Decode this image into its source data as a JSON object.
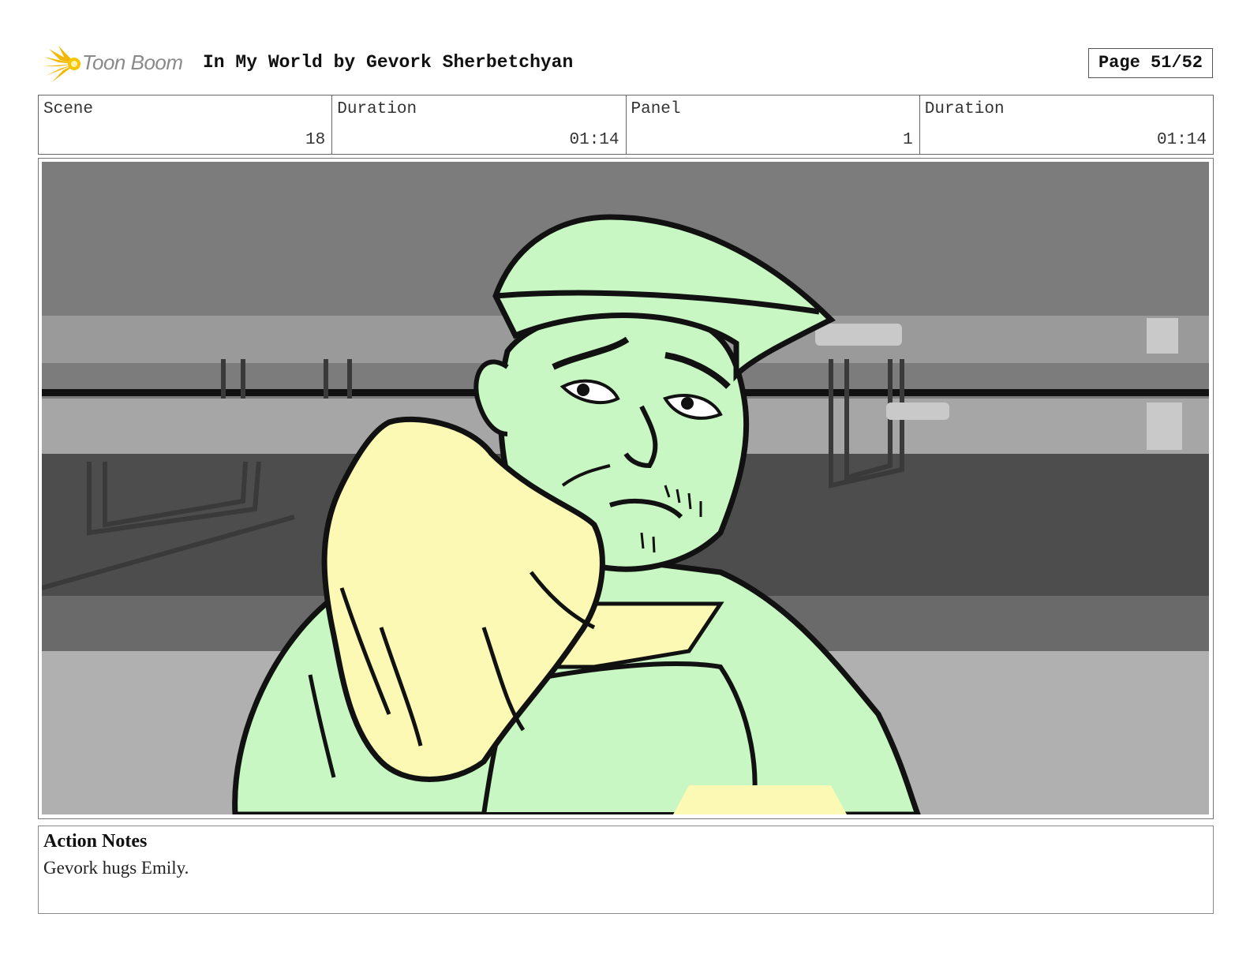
{
  "header": {
    "logo_text": "Toon Boom",
    "title": "In My World by Gevork Sherbetchyan",
    "page_label": "Page 51/52"
  },
  "info": {
    "scene_label": "Scene",
    "scene_value": "18",
    "scene_duration_label": "Duration",
    "scene_duration_value": "01:14",
    "panel_label": "Panel",
    "panel_value": "1",
    "panel_duration_label": "Duration",
    "panel_duration_value": "01:14"
  },
  "notes": {
    "title": "Action Notes",
    "text": "Gevork hugs Emily."
  },
  "colors": {
    "skin_green": "#c8f7c3",
    "hair_yellow": "#fbf9b3",
    "bg_dark_gray": "#7a7a7a",
    "bg_mid_gray": "#4a4a4a",
    "bg_light_gray": "#b0b0b0"
  }
}
